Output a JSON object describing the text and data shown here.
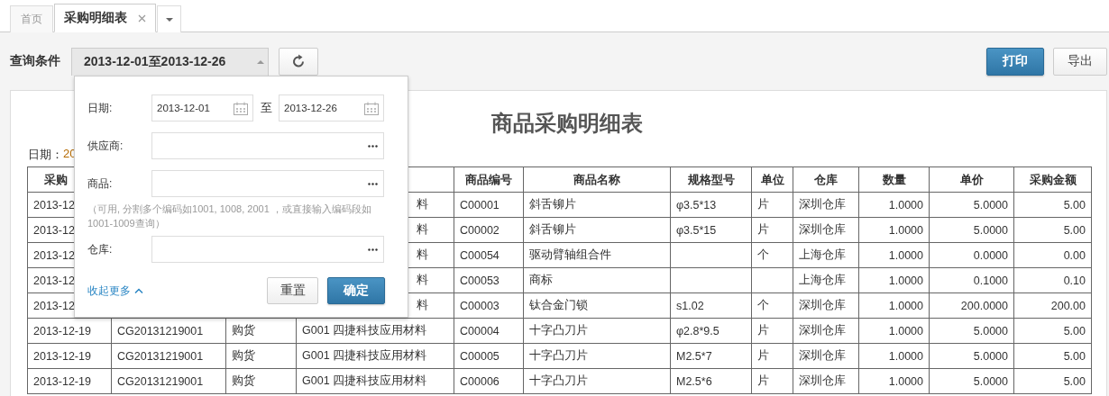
{
  "tabs": [
    {
      "label": "首页",
      "selected": false,
      "closable": false
    },
    {
      "label": "采购明细表",
      "selected": true,
      "closable": true
    }
  ],
  "toolbar": {
    "label": "查询条件",
    "range": "2013-12-01至2013-12-26",
    "expanded": true,
    "buttons": [
      {
        "label": "打印",
        "kind": "primary"
      },
      {
        "label": "导出",
        "kind": "default"
      }
    ]
  },
  "filter_popup": {
    "fields": [
      {
        "label": "日期:",
        "kind": "daterange",
        "from": "2013-12-01",
        "separator": "至",
        "to": "2013-12-26"
      },
      {
        "label": "供应商:",
        "kind": "picker"
      },
      {
        "label": "商品:",
        "kind": "picker",
        "hint": "（可用, 分割多个编码如1001, 1008, 2001 ，或直接输入编码段如1001-1009查询）"
      },
      {
        "label": "仓库:",
        "kind": "picker"
      }
    ],
    "collapse_link": "收起更多",
    "buttons": [
      {
        "label": "重置",
        "kind": "default"
      },
      {
        "label": "确定",
        "kind": "primary"
      }
    ]
  },
  "report": {
    "title": "商品采购明细表",
    "date_label": "日期：",
    "date_value": "20",
    "table": {
      "columns": [
        {
          "text": "采购",
          "clipped": true
        },
        null,
        null,
        null,
        {
          "text": "商品编号"
        },
        {
          "text": "商品名称"
        },
        {
          "text": "规格型号"
        },
        {
          "text": "单位"
        },
        {
          "text": "仓库"
        },
        {
          "text": "数量"
        },
        {
          "text": "单价"
        },
        {
          "text": "采购金额"
        }
      ],
      "rows": [
        {
          "cells": [
            {
              "text": "2013-12",
              "clipped": true
            },
            null,
            null,
            {
              "text": "料",
              "clipped": true
            },
            {
              "text": "C00001"
            },
            {
              "text": "斜舌铆片"
            },
            {
              "text": "φ3.5*13"
            },
            {
              "text": "片"
            },
            {
              "text": "深圳仓库"
            },
            {
              "text": "1.0000"
            },
            {
              "text": "5.0000"
            },
            {
              "text": "5.00"
            }
          ]
        },
        {
          "cells": [
            {
              "text": "2013-12",
              "clipped": true
            },
            null,
            null,
            {
              "text": "料",
              "clipped": true
            },
            {
              "text": "C00002"
            },
            {
              "text": "斜舌铆片"
            },
            {
              "text": "φ3.5*15"
            },
            {
              "text": "片"
            },
            {
              "text": "深圳仓库"
            },
            {
              "text": "1.0000"
            },
            {
              "text": "5.0000"
            },
            {
              "text": "5.00"
            }
          ]
        },
        {
          "cells": [
            {
              "text": "2013-12",
              "clipped": true
            },
            null,
            null,
            {
              "text": "料",
              "clipped": true
            },
            {
              "text": "C00054"
            },
            {
              "text": "驱动臂轴组合件"
            },
            null,
            {
              "text": "个"
            },
            {
              "text": "上海仓库"
            },
            {
              "text": "1.0000"
            },
            {
              "text": "0.0000"
            },
            {
              "text": "0.00"
            }
          ]
        },
        {
          "cells": [
            {
              "text": "2013-12",
              "clipped": true
            },
            null,
            null,
            {
              "text": "料",
              "clipped": true
            },
            {
              "text": "C00053"
            },
            {
              "text": "商标"
            },
            null,
            null,
            {
              "text": "上海仓库"
            },
            {
              "text": "1.0000"
            },
            {
              "text": "0.1000"
            },
            {
              "text": "0.10"
            }
          ]
        },
        {
          "cells": [
            {
              "text": "2013-12",
              "clipped": true
            },
            null,
            null,
            {
              "text": "料",
              "clipped": true
            },
            {
              "text": "C00003"
            },
            {
              "text": "钛合金门锁"
            },
            {
              "text": "s1.02"
            },
            {
              "text": "个"
            },
            {
              "text": "深圳仓库"
            },
            {
              "text": "1.0000"
            },
            {
              "text": "200.0000"
            },
            {
              "text": "200.00"
            }
          ]
        },
        {
          "cells": [
            {
              "text": "2013-12-19"
            },
            {
              "text": "CG20131219001"
            },
            {
              "text": "购货"
            },
            {
              "text": "G001 四捷科技应用材料"
            },
            {
              "text": "C00004"
            },
            {
              "text": "十字凸刀片"
            },
            {
              "text": "φ2.8*9.5"
            },
            {
              "text": "片"
            },
            {
              "text": "深圳仓库"
            },
            {
              "text": "1.0000"
            },
            {
              "text": "5.0000"
            },
            {
              "text": "5.00"
            }
          ]
        },
        {
          "cells": [
            {
              "text": "2013-12-19"
            },
            {
              "text": "CG20131219001"
            },
            {
              "text": "购货"
            },
            {
              "text": "G001 四捷科技应用材料"
            },
            {
              "text": "C00005"
            },
            {
              "text": "十字凸刀片"
            },
            {
              "text": "M2.5*7"
            },
            {
              "text": "片"
            },
            {
              "text": "深圳仓库"
            },
            {
              "text": "1.0000"
            },
            {
              "text": "5.0000"
            },
            {
              "text": "5.00"
            }
          ]
        },
        {
          "cells": [
            {
              "text": "2013-12-19"
            },
            {
              "text": "CG20131219001"
            },
            {
              "text": "购货"
            },
            {
              "text": "G001 四捷科技应用材料"
            },
            {
              "text": "C00006"
            },
            {
              "text": "十字凸刀片"
            },
            {
              "text": "M2.5*6"
            },
            {
              "text": "片"
            },
            {
              "text": "深圳仓库"
            },
            {
              "text": "1.0000"
            },
            {
              "text": "5.0000"
            },
            {
              "text": "5.00"
            }
          ]
        }
      ]
    }
  }
}
